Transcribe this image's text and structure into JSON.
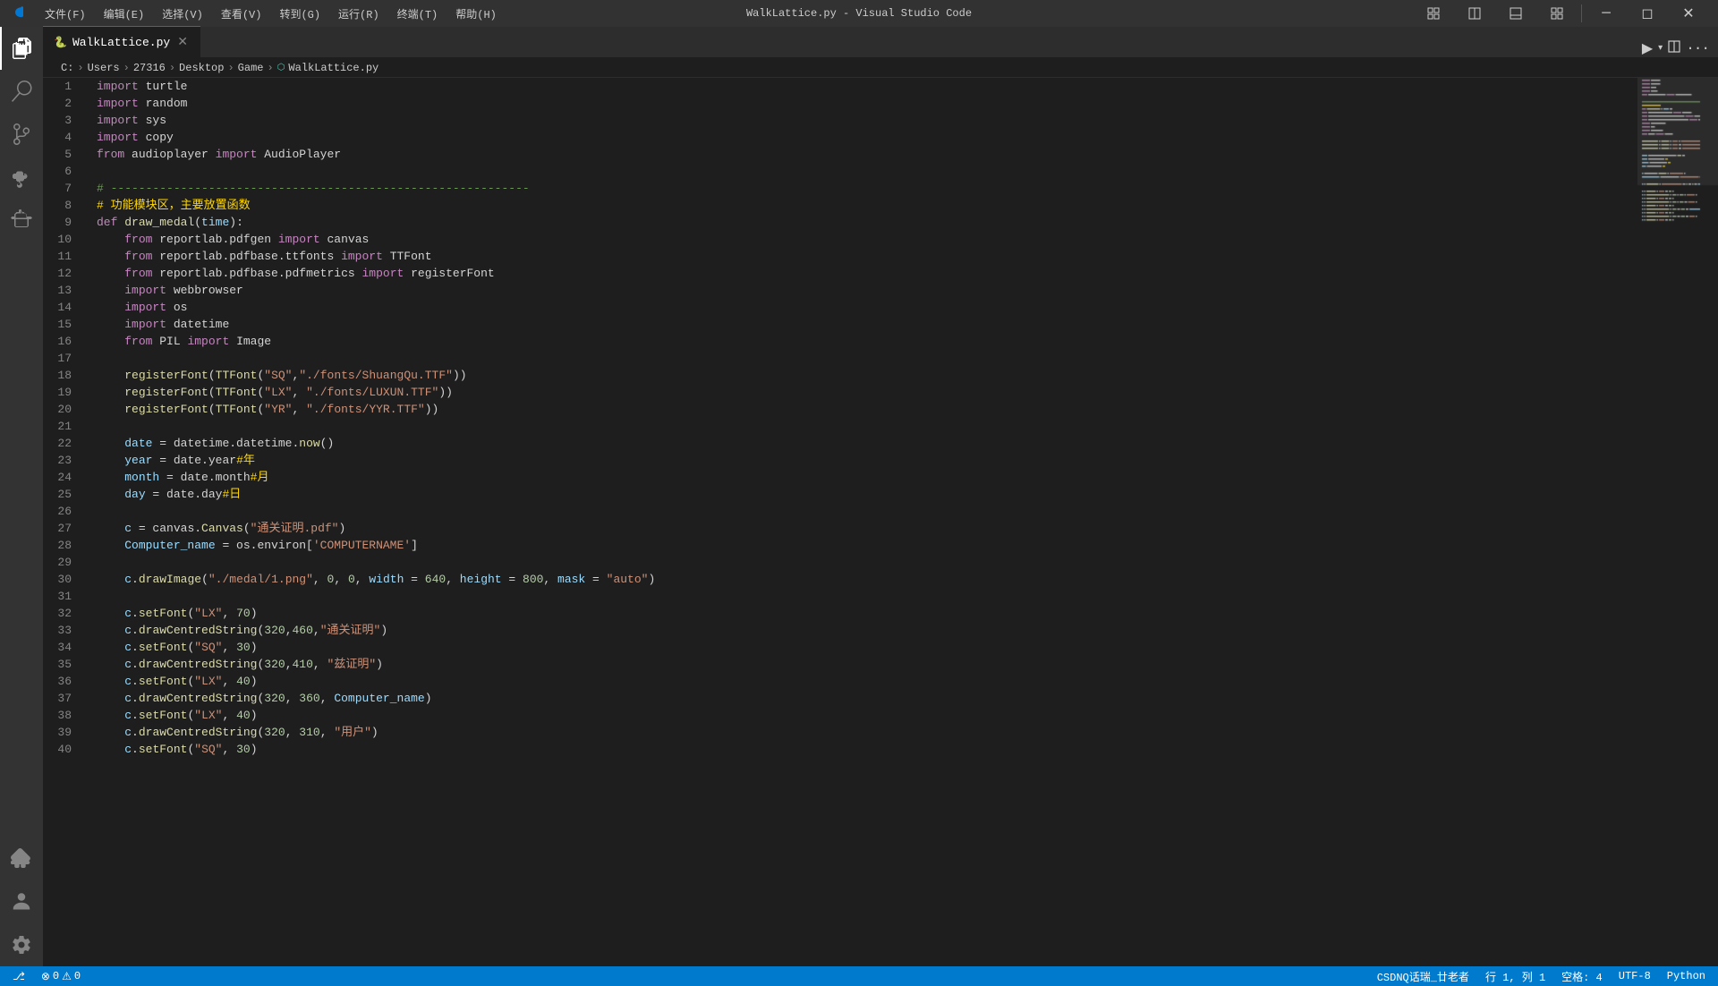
{
  "titleBar": {
    "title": "WalkLattice.py - Visual Studio Code",
    "menu": [
      "文件(F)",
      "编辑(E)",
      "选择(V)",
      "查看(V)",
      "转到(G)",
      "运行(R)",
      "终端(T)",
      "帮助(H)"
    ],
    "windowControls": [
      "minimize",
      "restore",
      "maximize",
      "close"
    ]
  },
  "breadcrumb": {
    "items": [
      "C:",
      "Users",
      "27316",
      "Desktop",
      "Game"
    ],
    "current": "WalkLattice.py"
  },
  "tab": {
    "filename": "WalkLattice.py",
    "language": "Python"
  },
  "statusBar": {
    "left": [
      "⊗ 0",
      "⚠ 0"
    ],
    "right": [
      "行 1, 列 1",
      "空格: 4",
      "UTF-8",
      "Python"
    ],
    "branch": "",
    "encoding": "UTF-8",
    "line": "行 1, 列 1",
    "spaces": "空格: 4",
    "language": "Python",
    "extra": "CSDNQ话瑞_廿老者"
  },
  "codeLines": [
    {
      "num": 1,
      "tokens": [
        {
          "t": "kw",
          "v": "import"
        },
        {
          "t": "plain",
          "v": " turtle"
        }
      ]
    },
    {
      "num": 2,
      "tokens": [
        {
          "t": "kw",
          "v": "import"
        },
        {
          "t": "plain",
          "v": " random"
        }
      ]
    },
    {
      "num": 3,
      "tokens": [
        {
          "t": "kw",
          "v": "import"
        },
        {
          "t": "plain",
          "v": " sys"
        }
      ]
    },
    {
      "num": 4,
      "tokens": [
        {
          "t": "kw",
          "v": "import"
        },
        {
          "t": "plain",
          "v": " copy"
        }
      ]
    },
    {
      "num": 5,
      "tokens": [
        {
          "t": "kw",
          "v": "from"
        },
        {
          "t": "plain",
          "v": " audioplayer "
        },
        {
          "t": "kw",
          "v": "import"
        },
        {
          "t": "plain",
          "v": " AudioPlayer"
        }
      ]
    },
    {
      "num": 6,
      "tokens": []
    },
    {
      "num": 7,
      "tokens": [
        {
          "t": "comment",
          "v": "# ------------------------------------------------------------"
        }
      ]
    },
    {
      "num": 8,
      "tokens": [
        {
          "t": "comment-cn",
          "v": "# 功能模块区，主要放置函数"
        }
      ]
    },
    {
      "num": 9,
      "tokens": [
        {
          "t": "kw",
          "v": "def"
        },
        {
          "t": "plain",
          "v": " "
        },
        {
          "t": "fn",
          "v": "draw_medal"
        },
        {
          "t": "plain",
          "v": "("
        },
        {
          "t": "var",
          "v": "time"
        },
        {
          "t": "plain",
          "v": "):"
        }
      ]
    },
    {
      "num": 10,
      "tokens": [
        {
          "t": "plain",
          "v": "    "
        },
        {
          "t": "kw",
          "v": "from"
        },
        {
          "t": "plain",
          "v": " reportlab.pdfgen "
        },
        {
          "t": "kw",
          "v": "import"
        },
        {
          "t": "plain",
          "v": " canvas"
        }
      ]
    },
    {
      "num": 11,
      "tokens": [
        {
          "t": "plain",
          "v": "    "
        },
        {
          "t": "kw",
          "v": "from"
        },
        {
          "t": "plain",
          "v": " reportlab.pdfbase.ttfonts "
        },
        {
          "t": "kw",
          "v": "import"
        },
        {
          "t": "plain",
          "v": " TTFont"
        }
      ]
    },
    {
      "num": 12,
      "tokens": [
        {
          "t": "plain",
          "v": "    "
        },
        {
          "t": "kw",
          "v": "from"
        },
        {
          "t": "plain",
          "v": " reportlab.pdfbase.pdfmetrics "
        },
        {
          "t": "kw",
          "v": "import"
        },
        {
          "t": "plain",
          "v": " registerFont"
        }
      ]
    },
    {
      "num": 13,
      "tokens": [
        {
          "t": "plain",
          "v": "    "
        },
        {
          "t": "kw",
          "v": "import"
        },
        {
          "t": "plain",
          "v": " webbrowser"
        }
      ]
    },
    {
      "num": 14,
      "tokens": [
        {
          "t": "plain",
          "v": "    "
        },
        {
          "t": "kw",
          "v": "import"
        },
        {
          "t": "plain",
          "v": " os"
        }
      ]
    },
    {
      "num": 15,
      "tokens": [
        {
          "t": "plain",
          "v": "    "
        },
        {
          "t": "kw",
          "v": "import"
        },
        {
          "t": "plain",
          "v": " datetime"
        }
      ]
    },
    {
      "num": 16,
      "tokens": [
        {
          "t": "plain",
          "v": "    "
        },
        {
          "t": "kw",
          "v": "from"
        },
        {
          "t": "plain",
          "v": " PIL "
        },
        {
          "t": "kw",
          "v": "import"
        },
        {
          "t": "plain",
          "v": " Image"
        }
      ]
    },
    {
      "num": 17,
      "tokens": []
    },
    {
      "num": 18,
      "tokens": [
        {
          "t": "plain",
          "v": "    "
        },
        {
          "t": "fn",
          "v": "registerFont"
        },
        {
          "t": "plain",
          "v": "("
        },
        {
          "t": "fn",
          "v": "TTFont"
        },
        {
          "t": "plain",
          "v": "("
        },
        {
          "t": "str",
          "v": "\"SQ\""
        },
        {
          "t": "plain",
          "v": ","
        },
        {
          "t": "str",
          "v": "\"./fonts/ShuangQu.TTF\""
        },
        {
          "t": "plain",
          "v": "))"
        }
      ]
    },
    {
      "num": 19,
      "tokens": [
        {
          "t": "plain",
          "v": "    "
        },
        {
          "t": "fn",
          "v": "registerFont"
        },
        {
          "t": "plain",
          "v": "("
        },
        {
          "t": "fn",
          "v": "TTFont"
        },
        {
          "t": "plain",
          "v": "("
        },
        {
          "t": "str",
          "v": "\"LX\""
        },
        {
          "t": "plain",
          "v": ", "
        },
        {
          "t": "str",
          "v": "\"./fonts/LUXUN.TTF\""
        },
        {
          "t": "plain",
          "v": "))"
        }
      ]
    },
    {
      "num": 20,
      "tokens": [
        {
          "t": "plain",
          "v": "    "
        },
        {
          "t": "fn",
          "v": "registerFont"
        },
        {
          "t": "plain",
          "v": "("
        },
        {
          "t": "fn",
          "v": "TTFont"
        },
        {
          "t": "plain",
          "v": "("
        },
        {
          "t": "str",
          "v": "\"YR\""
        },
        {
          "t": "plain",
          "v": ", "
        },
        {
          "t": "str",
          "v": "\"./fonts/YYR.TTF\""
        },
        {
          "t": "plain",
          "v": "))"
        }
      ]
    },
    {
      "num": 21,
      "tokens": []
    },
    {
      "num": 22,
      "tokens": [
        {
          "t": "plain",
          "v": "    "
        },
        {
          "t": "var",
          "v": "date"
        },
        {
          "t": "plain",
          "v": " = datetime.datetime."
        },
        {
          "t": "fn",
          "v": "now"
        },
        {
          "t": "plain",
          "v": "()"
        }
      ]
    },
    {
      "num": 23,
      "tokens": [
        {
          "t": "plain",
          "v": "    "
        },
        {
          "t": "var",
          "v": "year"
        },
        {
          "t": "plain",
          "v": " = date.year"
        },
        {
          "t": "comment-cn",
          "v": "#年"
        }
      ]
    },
    {
      "num": 24,
      "tokens": [
        {
          "t": "plain",
          "v": "    "
        },
        {
          "t": "var",
          "v": "month"
        },
        {
          "t": "plain",
          "v": " = date.month"
        },
        {
          "t": "comment-cn",
          "v": "#月"
        }
      ]
    },
    {
      "num": 25,
      "tokens": [
        {
          "t": "plain",
          "v": "    "
        },
        {
          "t": "var",
          "v": "day"
        },
        {
          "t": "plain",
          "v": " = date.day"
        },
        {
          "t": "comment-cn",
          "v": "#日"
        }
      ]
    },
    {
      "num": 26,
      "tokens": []
    },
    {
      "num": 27,
      "tokens": [
        {
          "t": "plain",
          "v": "    "
        },
        {
          "t": "var",
          "v": "c"
        },
        {
          "t": "plain",
          "v": " = canvas."
        },
        {
          "t": "fn",
          "v": "Canvas"
        },
        {
          "t": "plain",
          "v": "("
        },
        {
          "t": "str",
          "v": "\"通关证明.pdf\""
        },
        {
          "t": "plain",
          "v": ")"
        }
      ]
    },
    {
      "num": 28,
      "tokens": [
        {
          "t": "plain",
          "v": "    "
        },
        {
          "t": "var",
          "v": "Computer_name"
        },
        {
          "t": "plain",
          "v": " = os.environ["
        },
        {
          "t": "str",
          "v": "'COMPUTERNAME'"
        },
        {
          "t": "plain",
          "v": "]"
        }
      ]
    },
    {
      "num": 29,
      "tokens": []
    },
    {
      "num": 30,
      "tokens": [
        {
          "t": "plain",
          "v": "    "
        },
        {
          "t": "var",
          "v": "c"
        },
        {
          "t": "plain",
          "v": "."
        },
        {
          "t": "fn",
          "v": "drawImage"
        },
        {
          "t": "plain",
          "v": "("
        },
        {
          "t": "str",
          "v": "\"./medal/1.png\""
        },
        {
          "t": "plain",
          "v": ", "
        },
        {
          "t": "num",
          "v": "0"
        },
        {
          "t": "plain",
          "v": ", "
        },
        {
          "t": "num",
          "v": "0"
        },
        {
          "t": "plain",
          "v": ", "
        },
        {
          "t": "var",
          "v": "width"
        },
        {
          "t": "plain",
          "v": " = "
        },
        {
          "t": "num",
          "v": "640"
        },
        {
          "t": "plain",
          "v": ", "
        },
        {
          "t": "var",
          "v": "height"
        },
        {
          "t": "plain",
          "v": " = "
        },
        {
          "t": "num",
          "v": "800"
        },
        {
          "t": "plain",
          "v": ", "
        },
        {
          "t": "var",
          "v": "mask"
        },
        {
          "t": "plain",
          "v": " = "
        },
        {
          "t": "str",
          "v": "\"auto\""
        },
        {
          "t": "plain",
          "v": ")"
        }
      ]
    },
    {
      "num": 31,
      "tokens": []
    },
    {
      "num": 32,
      "tokens": [
        {
          "t": "plain",
          "v": "    "
        },
        {
          "t": "var",
          "v": "c"
        },
        {
          "t": "plain",
          "v": "."
        },
        {
          "t": "fn",
          "v": "setFont"
        },
        {
          "t": "plain",
          "v": "("
        },
        {
          "t": "str",
          "v": "\"LX\""
        },
        {
          "t": "plain",
          "v": ", "
        },
        {
          "t": "num",
          "v": "70"
        },
        {
          "t": "plain",
          "v": ")"
        }
      ]
    },
    {
      "num": 33,
      "tokens": [
        {
          "t": "plain",
          "v": "    "
        },
        {
          "t": "var",
          "v": "c"
        },
        {
          "t": "plain",
          "v": "."
        },
        {
          "t": "fn",
          "v": "drawCentredString"
        },
        {
          "t": "plain",
          "v": "("
        },
        {
          "t": "num",
          "v": "320"
        },
        {
          "t": "plain",
          "v": ","
        },
        {
          "t": "num",
          "v": "460"
        },
        {
          "t": "plain",
          "v": ","
        },
        {
          "t": "str",
          "v": "\"通关证明\""
        },
        {
          "t": "plain",
          "v": ")"
        }
      ]
    },
    {
      "num": 34,
      "tokens": [
        {
          "t": "plain",
          "v": "    "
        },
        {
          "t": "var",
          "v": "c"
        },
        {
          "t": "plain",
          "v": "."
        },
        {
          "t": "fn",
          "v": "setFont"
        },
        {
          "t": "plain",
          "v": "("
        },
        {
          "t": "str",
          "v": "\"SQ\""
        },
        {
          "t": "plain",
          "v": ", "
        },
        {
          "t": "num",
          "v": "30"
        },
        {
          "t": "plain",
          "v": ")"
        }
      ]
    },
    {
      "num": 35,
      "tokens": [
        {
          "t": "plain",
          "v": "    "
        },
        {
          "t": "var",
          "v": "c"
        },
        {
          "t": "plain",
          "v": "."
        },
        {
          "t": "fn",
          "v": "drawCentredString"
        },
        {
          "t": "plain",
          "v": "("
        },
        {
          "t": "num",
          "v": "320"
        },
        {
          "t": "plain",
          "v": ","
        },
        {
          "t": "num",
          "v": "410"
        },
        {
          "t": "plain",
          "v": ", "
        },
        {
          "t": "str",
          "v": "\"兹证明\""
        },
        {
          "t": "plain",
          "v": ")"
        }
      ]
    },
    {
      "num": 36,
      "tokens": [
        {
          "t": "plain",
          "v": "    "
        },
        {
          "t": "var",
          "v": "c"
        },
        {
          "t": "plain",
          "v": "."
        },
        {
          "t": "fn",
          "v": "setFont"
        },
        {
          "t": "plain",
          "v": "("
        },
        {
          "t": "str",
          "v": "\"LX\""
        },
        {
          "t": "plain",
          "v": ", "
        },
        {
          "t": "num",
          "v": "40"
        },
        {
          "t": "plain",
          "v": ")"
        }
      ]
    },
    {
      "num": 37,
      "tokens": [
        {
          "t": "plain",
          "v": "    "
        },
        {
          "t": "var",
          "v": "c"
        },
        {
          "t": "plain",
          "v": "."
        },
        {
          "t": "fn",
          "v": "drawCentredString"
        },
        {
          "t": "plain",
          "v": "("
        },
        {
          "t": "num",
          "v": "320"
        },
        {
          "t": "plain",
          "v": ", "
        },
        {
          "t": "num",
          "v": "360"
        },
        {
          "t": "plain",
          "v": ", "
        },
        {
          "t": "var",
          "v": "Computer_name"
        },
        {
          "t": "plain",
          "v": ")"
        }
      ]
    },
    {
      "num": 38,
      "tokens": [
        {
          "t": "plain",
          "v": "    "
        },
        {
          "t": "var",
          "v": "c"
        },
        {
          "t": "plain",
          "v": "."
        },
        {
          "t": "fn",
          "v": "setFont"
        },
        {
          "t": "plain",
          "v": "("
        },
        {
          "t": "str",
          "v": "\"LX\""
        },
        {
          "t": "plain",
          "v": ", "
        },
        {
          "t": "num",
          "v": "40"
        },
        {
          "t": "plain",
          "v": ")"
        }
      ]
    },
    {
      "num": 39,
      "tokens": [
        {
          "t": "plain",
          "v": "    "
        },
        {
          "t": "var",
          "v": "c"
        },
        {
          "t": "plain",
          "v": "."
        },
        {
          "t": "fn",
          "v": "drawCentredString"
        },
        {
          "t": "plain",
          "v": "("
        },
        {
          "t": "num",
          "v": "320"
        },
        {
          "t": "plain",
          "v": ", "
        },
        {
          "t": "num",
          "v": "310"
        },
        {
          "t": "plain",
          "v": ", "
        },
        {
          "t": "str",
          "v": "\"用户\""
        },
        {
          "t": "plain",
          "v": ")"
        }
      ]
    },
    {
      "num": 40,
      "tokens": [
        {
          "t": "plain",
          "v": "    "
        },
        {
          "t": "var",
          "v": "c"
        },
        {
          "t": "plain",
          "v": "."
        },
        {
          "t": "fn",
          "v": "setFont"
        },
        {
          "t": "plain",
          "v": "("
        },
        {
          "t": "str",
          "v": "\"SQ\""
        },
        {
          "t": "plain",
          "v": ", "
        },
        {
          "t": "num",
          "v": "30"
        },
        {
          "t": "plain",
          "v": ")"
        }
      ]
    }
  ],
  "activityBar": {
    "items": [
      {
        "name": "explorer",
        "icon": "files"
      },
      {
        "name": "search",
        "icon": "search"
      },
      {
        "name": "source-control",
        "icon": "git"
      },
      {
        "name": "run-debug",
        "icon": "run"
      },
      {
        "name": "extensions",
        "icon": "extensions"
      },
      {
        "name": "remote-explorer",
        "icon": "remote"
      },
      {
        "name": "testing",
        "icon": "testing"
      }
    ],
    "bottomItems": [
      {
        "name": "accounts",
        "icon": "account"
      },
      {
        "name": "settings",
        "icon": "gear"
      }
    ]
  }
}
